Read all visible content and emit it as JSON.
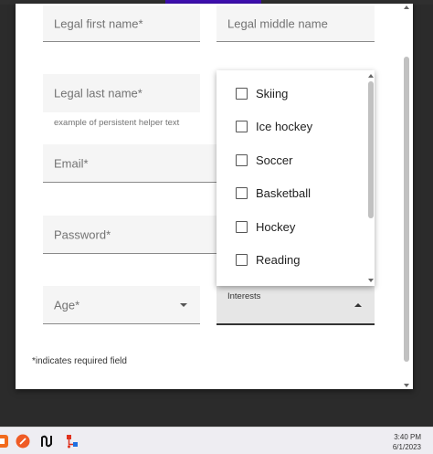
{
  "form": {
    "first_name_placeholder": "Legal first name*",
    "middle_name_placeholder": "Legal middle name",
    "last_name_placeholder": "Legal last name*",
    "last_name_helper": "example of persistent helper text",
    "email_placeholder": "Email*",
    "password_placeholder": "Password*",
    "age_placeholder": "Age*",
    "interests_label": "Interests",
    "required_note": "*indicates required field"
  },
  "interests_menu": {
    "options": [
      {
        "label": "Skiing",
        "checked": false
      },
      {
        "label": "Ice hockey",
        "checked": false
      },
      {
        "label": "Soccer",
        "checked": false
      },
      {
        "label": "Basketball",
        "checked": false
      },
      {
        "label": "Hockey",
        "checked": false
      },
      {
        "label": "Reading",
        "checked": false
      }
    ]
  },
  "taskbar": {
    "time": "3:40 PM",
    "date": "6/1/2023",
    "icons": [
      "app-orange-icon",
      "postman-icon",
      "notion-icon",
      "network-app-icon"
    ]
  },
  "colors": {
    "accent": "#3f0fb3",
    "field_bg": "#f5f5f5",
    "taskbar_bg": "#eeedf2"
  }
}
